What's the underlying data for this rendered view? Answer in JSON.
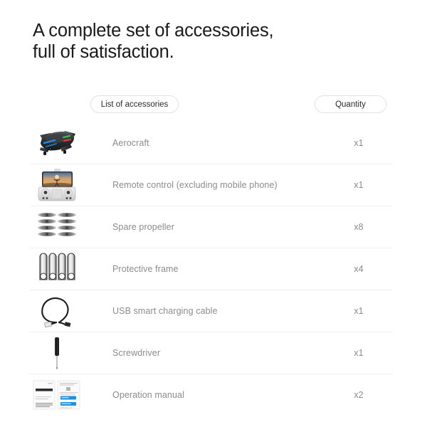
{
  "heading": {
    "line1": "A complete set of accessories,",
    "line2": "full of satisfaction."
  },
  "table": {
    "headers": {
      "name": "List of accessories",
      "quantity": "Quantity"
    },
    "rows": [
      {
        "icon": "drone-aircraft-image",
        "name": "Aerocraft",
        "quantity": "x1"
      },
      {
        "icon": "remote-controller-image",
        "name": "Remote control (excluding mobile phone)",
        "quantity": "x1"
      },
      {
        "icon": "spare-propellers-image",
        "name": "Spare propeller",
        "quantity": "x8"
      },
      {
        "icon": "protective-frame-image",
        "name": "Protective frame",
        "quantity": "x4"
      },
      {
        "icon": "usb-charging-cable-image",
        "name": "USB smart charging cable",
        "quantity": "x1"
      },
      {
        "icon": "screwdriver-image",
        "name": "Screwdriver",
        "quantity": "x1"
      },
      {
        "icon": "operation-manual-image",
        "name": "Operation manual",
        "quantity": "x2"
      }
    ]
  },
  "colors": {
    "background": "#ffffff",
    "heading_text": "#1a1a1a",
    "row_text": "#8c8c8c",
    "divider": "#f0f0f0",
    "pill_border": "#e2e2e2",
    "accent_blue": "#1f8fe0",
    "accent_green": "#35c24a",
    "accent_red": "#e03a3a"
  }
}
